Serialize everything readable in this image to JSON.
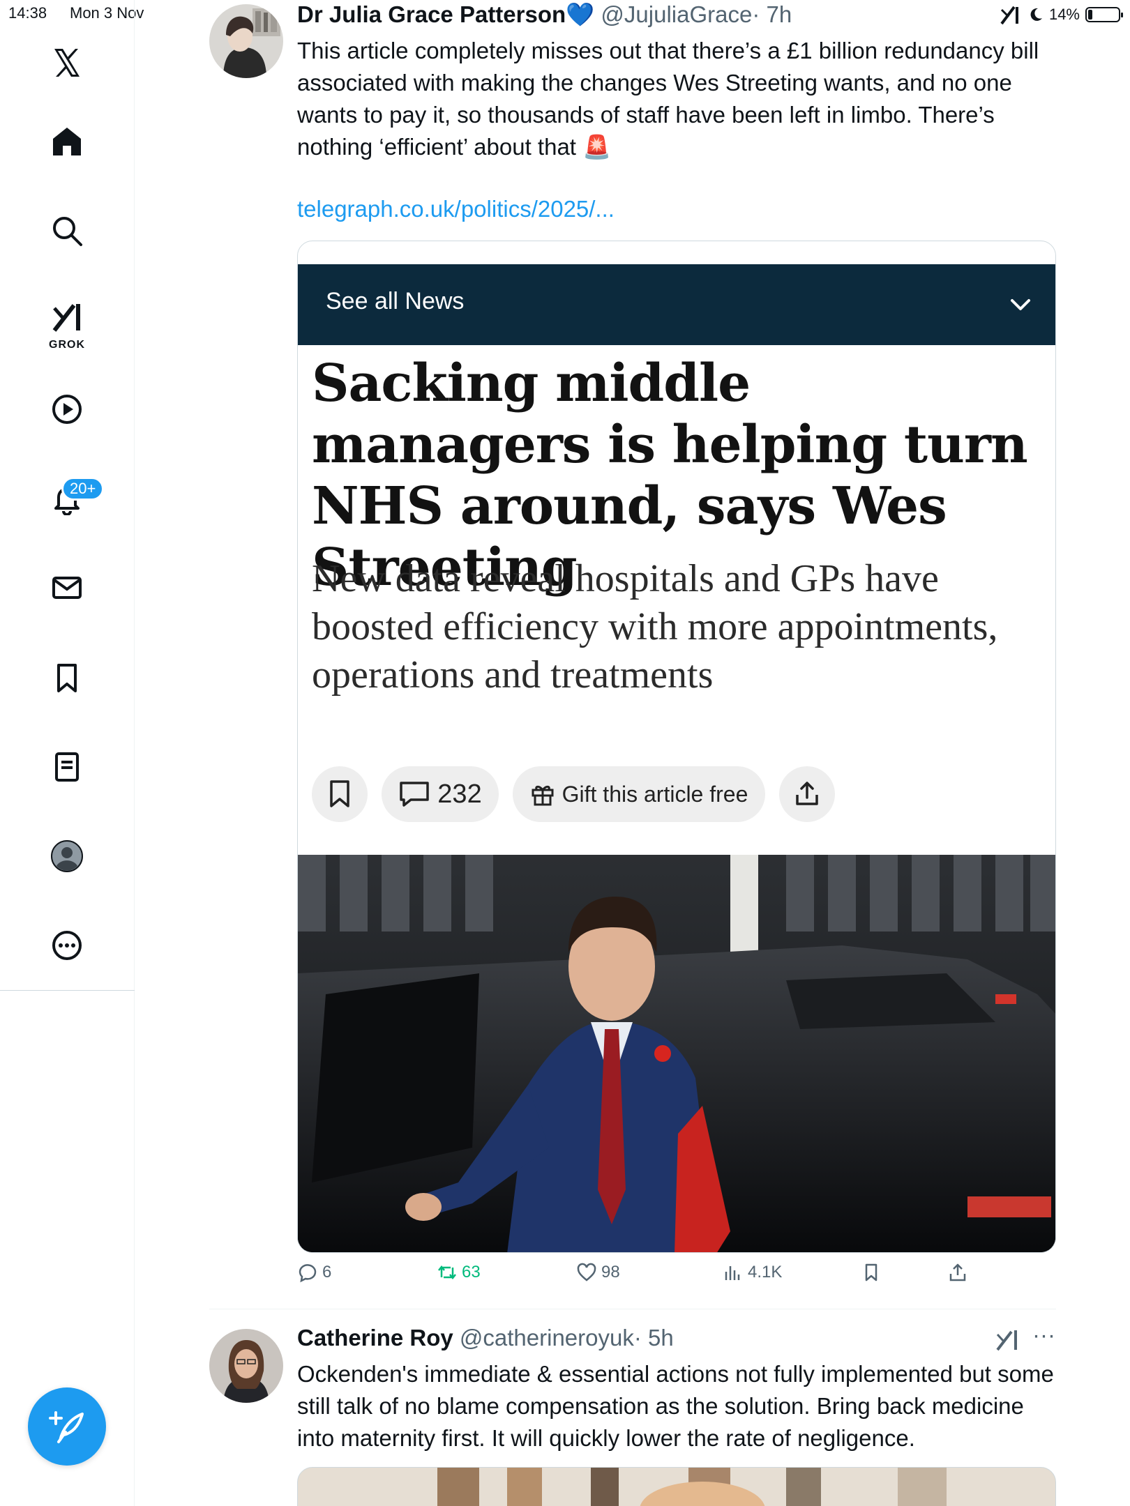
{
  "status_bar": {
    "time": "14:38",
    "date": "Mon 3 Nov",
    "battery": "14%",
    "battery_level": 0.14
  },
  "sidebar": {
    "items": [
      {
        "icon": "x-logo-icon"
      },
      {
        "icon": "home-icon"
      },
      {
        "icon": "search-icon"
      },
      {
        "icon": "grok-icon",
        "label": "GROK"
      },
      {
        "icon": "video-play-icon"
      },
      {
        "icon": "bell-icon",
        "badge": "20+"
      },
      {
        "icon": "mail-icon"
      },
      {
        "icon": "bookmark-icon"
      },
      {
        "icon": "list-icon"
      },
      {
        "icon": "profile-icon"
      },
      {
        "icon": "more-icon"
      }
    ],
    "compose_icon": "compose-icon"
  },
  "tweet1": {
    "name": "Dr Julia Grace Patterson💙",
    "handle": "@JujuliaGrace",
    "time": "· 7h",
    "text": "This article completely misses out that there’s a £1 billion redundancy bill associated with making the changes Wes Streeting wants, and no one wants to pay it, so thousands of staff have been left in limbo. There’s nothing ‘efficient’ about that 🚨",
    "link": "telegraph.co.uk/politics/2025/...",
    "card": {
      "news_bar": "See all News",
      "headline": "Sacking middle managers is helping turn NHS around, says Wes Streeting",
      "standfirst": "New data reveal hospitals and GPs have boosted efficiency with more appointments, operations and treatments",
      "comment_count": "232",
      "gift_label": "Gift this article free"
    },
    "stats": {
      "replies": "6",
      "reposts": "63",
      "likes": "98",
      "views": "4.1K"
    }
  },
  "tweet2": {
    "name": "Catherine Roy",
    "handle": "@catherineroyuk",
    "time": "· 5h",
    "more": "···",
    "text": "Ockenden's immediate & essential actions not fully implemented but some still talk of no blame compensation as the solution. Bring back medicine into maternity first. It will quickly lower the rate of negligence."
  },
  "colors": {
    "accent": "#1d9bf0",
    "news_bar": "#0c2a3d",
    "repost": "#00ba7c",
    "muted": "#536471"
  }
}
